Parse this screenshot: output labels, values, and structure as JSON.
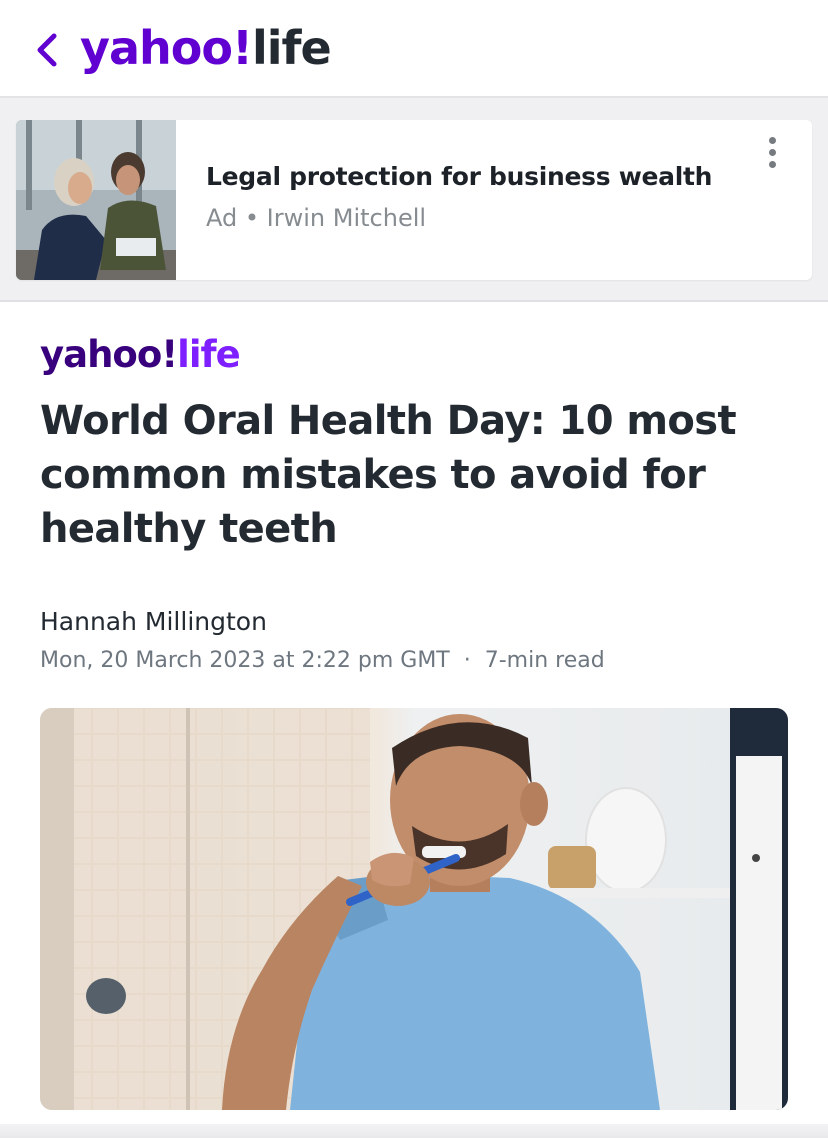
{
  "header": {
    "back_icon": "chevron-left-icon",
    "brand_yahoo": "yahoo!",
    "brand_section": "life",
    "brand_color": "#6001d2"
  },
  "ad": {
    "title": "Legal protection for business wealth",
    "label": "Ad",
    "separator": "•",
    "advertiser": "Irwin Mitchell",
    "menu_icon": "more-vertical-icon"
  },
  "article": {
    "brand_yahoo": "yahoo!",
    "brand_section": "life",
    "headline": "World Oral Health Day: 10 most common mistakes to avoid for healthy teeth",
    "author": "Hannah Millington",
    "date": "Mon, 20 March 2023 at 2:22 pm GMT",
    "separator": "·",
    "read_time": "7-min read"
  }
}
